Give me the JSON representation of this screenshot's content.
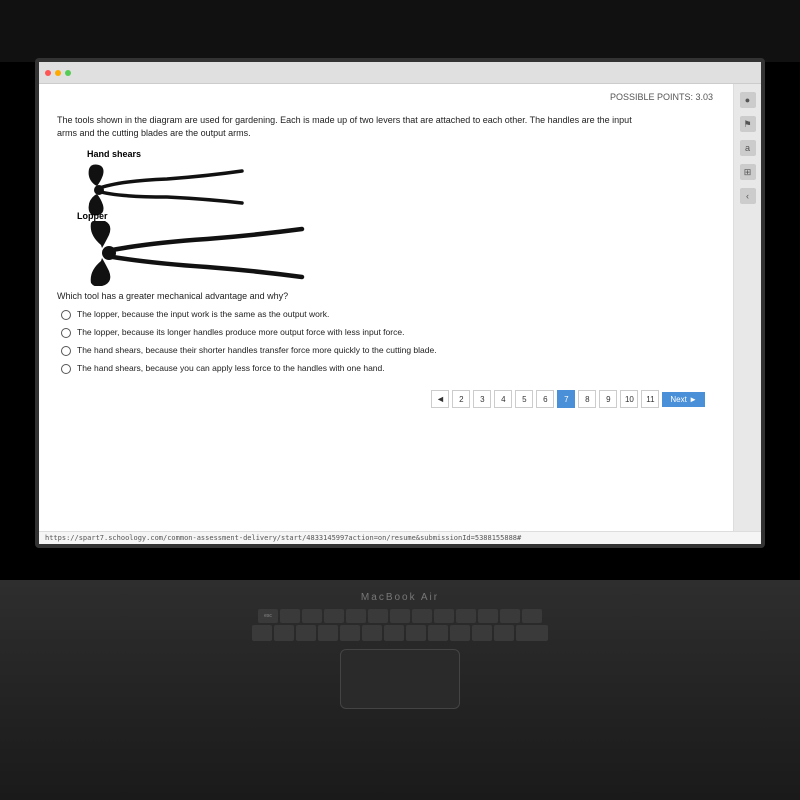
{
  "possible_points": "POSSIBLE POINTS: 3.03",
  "question_text": "The tools shown in the diagram are used for gardening.  Each is made up of two levers that are attached to each other.  The handles are the input arms and the cutting blades are the output arms.",
  "tool1_label": "Hand shears",
  "tool2_label": "Lopper",
  "question_prompt": "Which tool has a greater mechanical advantage and why?",
  "options": [
    "The lopper, because the input work is the same as the output work.",
    "The lopper, because its longer handles produce more output force with less input force.",
    "The hand shears, because their shorter handles transfer force more quickly to the cutting blade.",
    "The hand shears, because you can apply less force to the handles with one hand."
  ],
  "pagination": {
    "prev": "◄",
    "pages": [
      "2",
      "3",
      "4",
      "5",
      "6",
      "7",
      "8",
      "9",
      "10",
      "11"
    ],
    "active_page": "7",
    "next_label": "Next ►"
  },
  "url": "https://spart7.schoology.com/common-assessment-delivery/start/4833145997action=on/resume&submissionId=5388155888#",
  "macbook_label": "MacBook Air",
  "sidebar_icons": [
    "●",
    "⚑",
    "a",
    "⊞",
    "‹"
  ]
}
